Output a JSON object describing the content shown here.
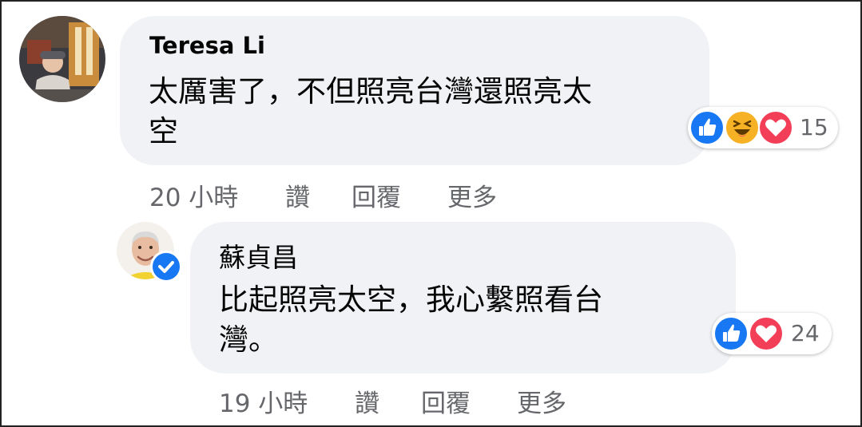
{
  "comments": [
    {
      "author": "Teresa Li",
      "text_lines": [
        "太厲害了，不但照亮台灣還照亮太",
        "空"
      ],
      "reaction_icons": [
        "like-icon",
        "haha-icon",
        "love-icon"
      ],
      "reaction_count": "15",
      "time": "20 小時",
      "actions": {
        "like": "讚",
        "reply": "回覆",
        "more": "更多"
      }
    },
    {
      "author": "蘇貞昌",
      "verified": true,
      "text_lines": [
        "比起照亮太空，我心繫照看台",
        "灣。"
      ],
      "reaction_icons": [
        "like-icon",
        "love-icon"
      ],
      "reaction_count": "24",
      "time": "19 小時",
      "actions": {
        "like": "讚",
        "reply": "回覆",
        "more": "更多"
      }
    }
  ],
  "colors": {
    "bubble": "#f0f2f5",
    "like": "#1877f2",
    "love": "#f33e58",
    "haha": "#f7b125",
    "meta_text": "#65676b"
  }
}
